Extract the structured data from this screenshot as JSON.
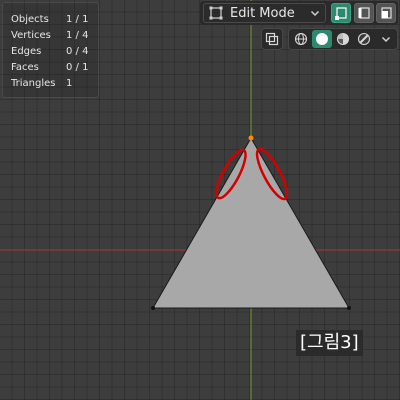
{
  "stats": [
    {
      "label": "Objects",
      "value": "1 / 1"
    },
    {
      "label": "Vertices",
      "value": "1 / 4"
    },
    {
      "label": "Edges",
      "value": "0 / 4"
    },
    {
      "label": "Faces",
      "value": "0 / 1"
    },
    {
      "label": "Triangles",
      "value": "1"
    }
  ],
  "header": {
    "mode_label": "Edit Mode",
    "mode_icon": "edit-mode-icon",
    "select_modes": [
      "vertex-select",
      "edge-select",
      "face-select"
    ],
    "active_select_mode": "vertex-select"
  },
  "shading": {
    "modes": [
      "wireframe",
      "solid",
      "material-preview",
      "rendered"
    ],
    "active": "solid"
  },
  "caption": "[그림3]",
  "colors": {
    "accent": "#2d8a6f",
    "axis_x": "#9b3a3a",
    "axis_y": "#6b8a28",
    "face": "#a8a8a8",
    "selected_vertex": "#ff8c00",
    "annotation": "#d40000"
  }
}
